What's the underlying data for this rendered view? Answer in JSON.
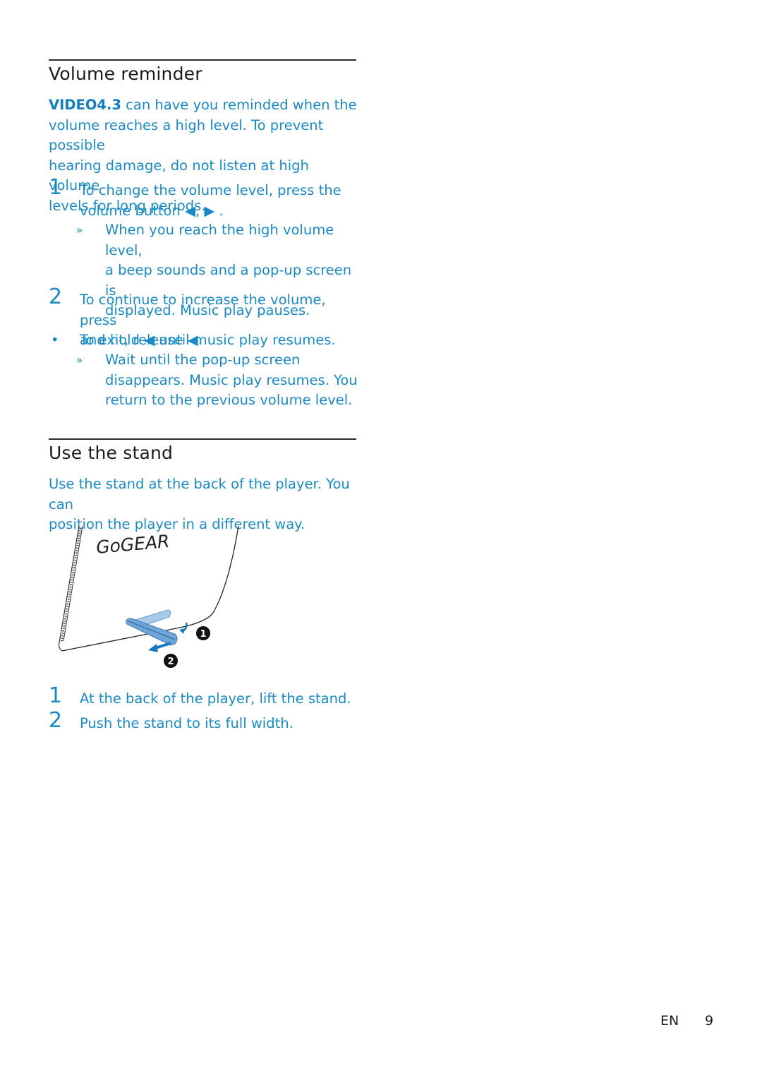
{
  "sections": {
    "volume_reminder": {
      "title": "Volume reminder",
      "intro_product": "VIDEO4.3",
      "intro_rest_lines": [
        " can have you reminded when the",
        "volume reaches a high level. To prevent possible",
        "hearing damage, do not listen at high volume",
        "levels for long periods."
      ],
      "steps": [
        {
          "number": "1",
          "lines": [
            "To change the volume level, press the",
            "volume button ◀, ▶ ."
          ],
          "result_marker": "»",
          "result_lines": [
            "When you reach the high volume level,",
            "a beep sounds and a pop-up screen is",
            "displayed. Music play pauses."
          ]
        },
        {
          "number": "2",
          "lines": [
            "To continue to increase the volume, press",
            "and hold ◀ until music play resumes."
          ]
        }
      ],
      "bullet": {
        "marker": "•",
        "text": "To exit, release ◀.",
        "result_marker": "»",
        "result_lines": [
          "Wait until the pop-up screen",
          "disappears. Music play resumes. You",
          "return to the previous volume level."
        ]
      }
    },
    "use_stand": {
      "title": "Use the stand",
      "intro_lines": [
        "Use the stand at the back of the player. You can",
        "position the player in a different way."
      ],
      "illustration": {
        "brand_text": "GoGEAR",
        "callout_1": "1",
        "callout_2": "2"
      },
      "steps": [
        {
          "number": "1",
          "text": "At the back of the player, lift the stand."
        },
        {
          "number": "2",
          "text": "Push the stand to its full width."
        }
      ]
    }
  },
  "footer": {
    "language": "EN",
    "page_number": "9"
  },
  "colors": {
    "accent_blue": "#1a8ac6",
    "heading": "#1a1a1a"
  }
}
